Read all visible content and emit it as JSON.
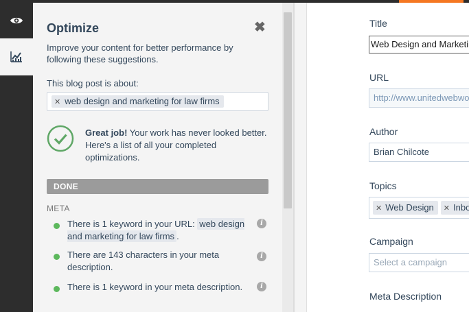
{
  "colors": {
    "accent": "#f57722",
    "rail": "#2d2d2d",
    "success": "#5cb85c",
    "done_bar": "#9b9b9b"
  },
  "rail": {
    "items": [
      {
        "icon": "eye-icon"
      },
      {
        "icon": "chart-icon"
      }
    ]
  },
  "optimize": {
    "title": "Optimize",
    "close_icon": "close-icon",
    "description": "Improve your content for better performance by following these suggestions.",
    "about_label": "This blog post is about:",
    "topic_tag": "web design and marketing for law firms",
    "great_job_bold": "Great job!",
    "great_job_text": " Your work has never looked better. Here's a list of all your completed optimizations.",
    "done_label": "DONE",
    "meta_label": "META",
    "items": [
      {
        "text_before": "There is 1 keyword in your URL: ",
        "keyword": "web design and marketing for law firms",
        "text_after": "."
      },
      {
        "text": "There are 143 characters in your meta description."
      },
      {
        "text": "There is 1 keyword in your meta description."
      }
    ]
  },
  "form": {
    "title_label": "Title",
    "title_value": "Web Design and Marketing",
    "url_label": "URL",
    "url_value": "http://www.unitedwebworks",
    "author_label": "Author",
    "author_value": "Brian Chilcote",
    "topics_label": "Topics",
    "topics": [
      "Web Design",
      "Inbound"
    ],
    "campaign_label": "Campaign",
    "campaign_placeholder": "Select a campaign",
    "meta_description_label": "Meta Description"
  }
}
